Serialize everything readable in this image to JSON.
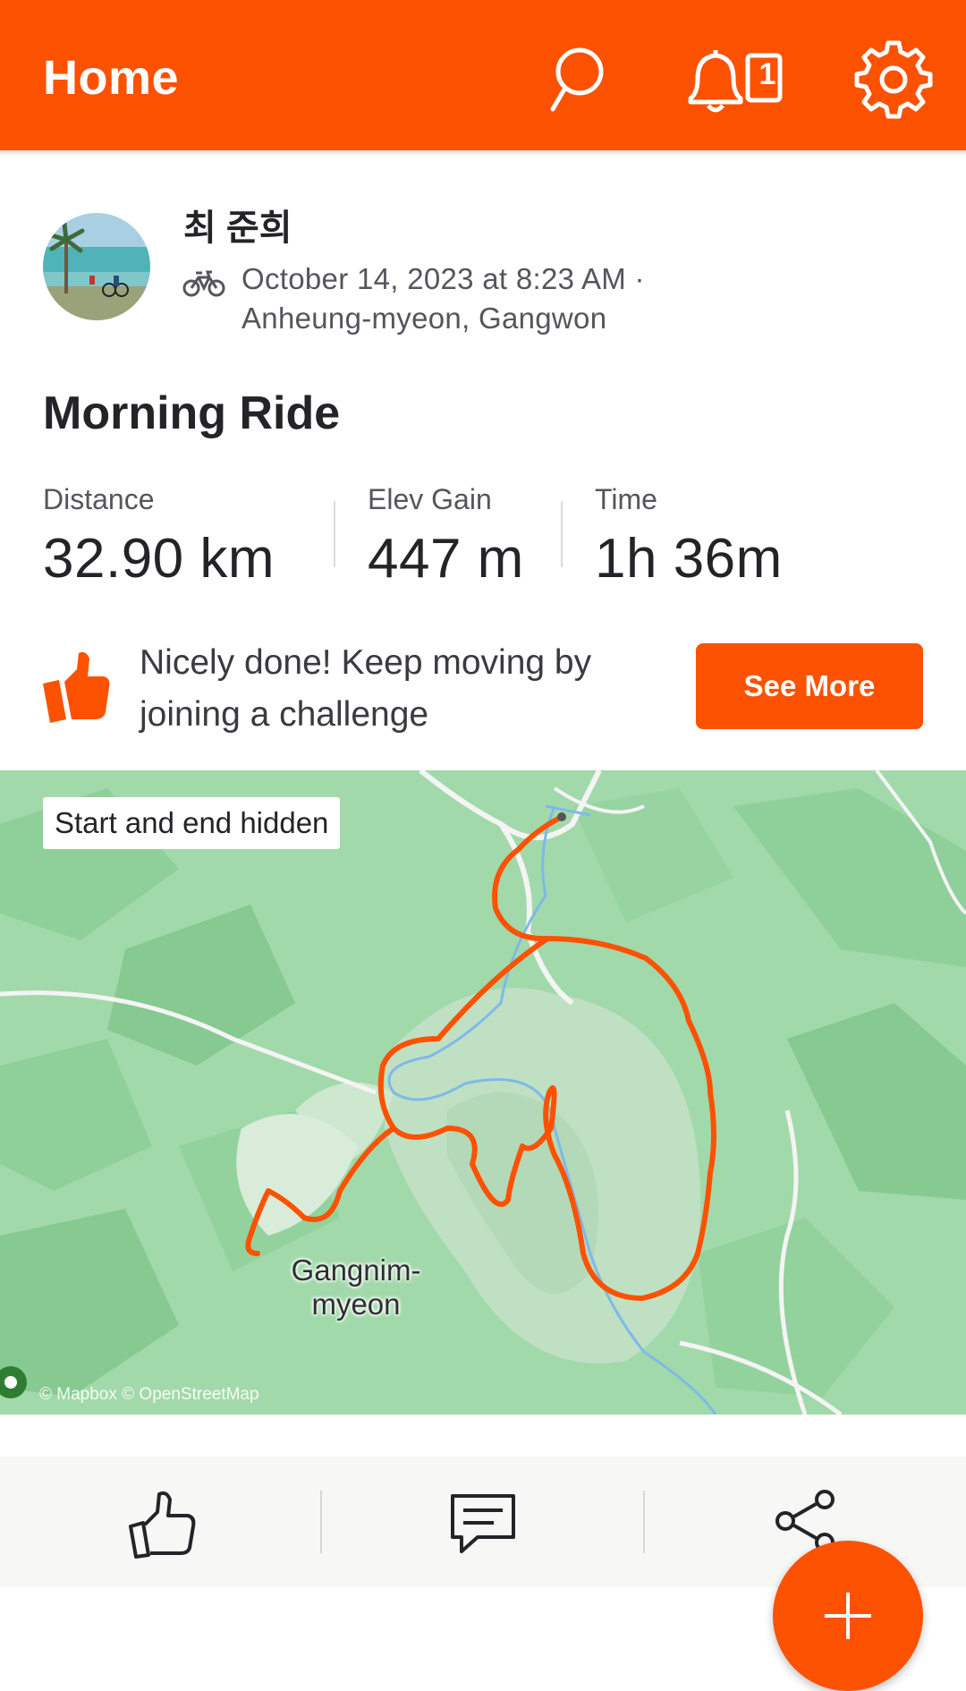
{
  "header": {
    "title": "Home",
    "notification_count": "1",
    "accent_color": "#fc5200"
  },
  "athlete": {
    "name": "최 준희",
    "activity_icon": "bike-icon",
    "datetime": "October 14, 2023 at 8:23 AM ·",
    "location": "Anheung-myeon, Gangwon"
  },
  "activity": {
    "title": "Morning Ride",
    "stats": [
      {
        "label": "Distance",
        "value": "32.90 km"
      },
      {
        "label": "Elev Gain",
        "value": "447 m"
      },
      {
        "label": "Time",
        "value": "1h 36m"
      }
    ]
  },
  "challenge_prompt": {
    "text": "Nicely done! Keep moving by joining a challenge",
    "button": "See More"
  },
  "map": {
    "privacy_chip": "Start and end hidden",
    "town_label": "Gangnim-myeon",
    "attribution": "© Mapbox © OpenStreetMap",
    "route_color": "#fc5200"
  },
  "actions": {
    "icons": [
      "kudos-icon",
      "comment-icon",
      "share-icon"
    ]
  },
  "fab": {
    "icon": "plus-icon"
  }
}
